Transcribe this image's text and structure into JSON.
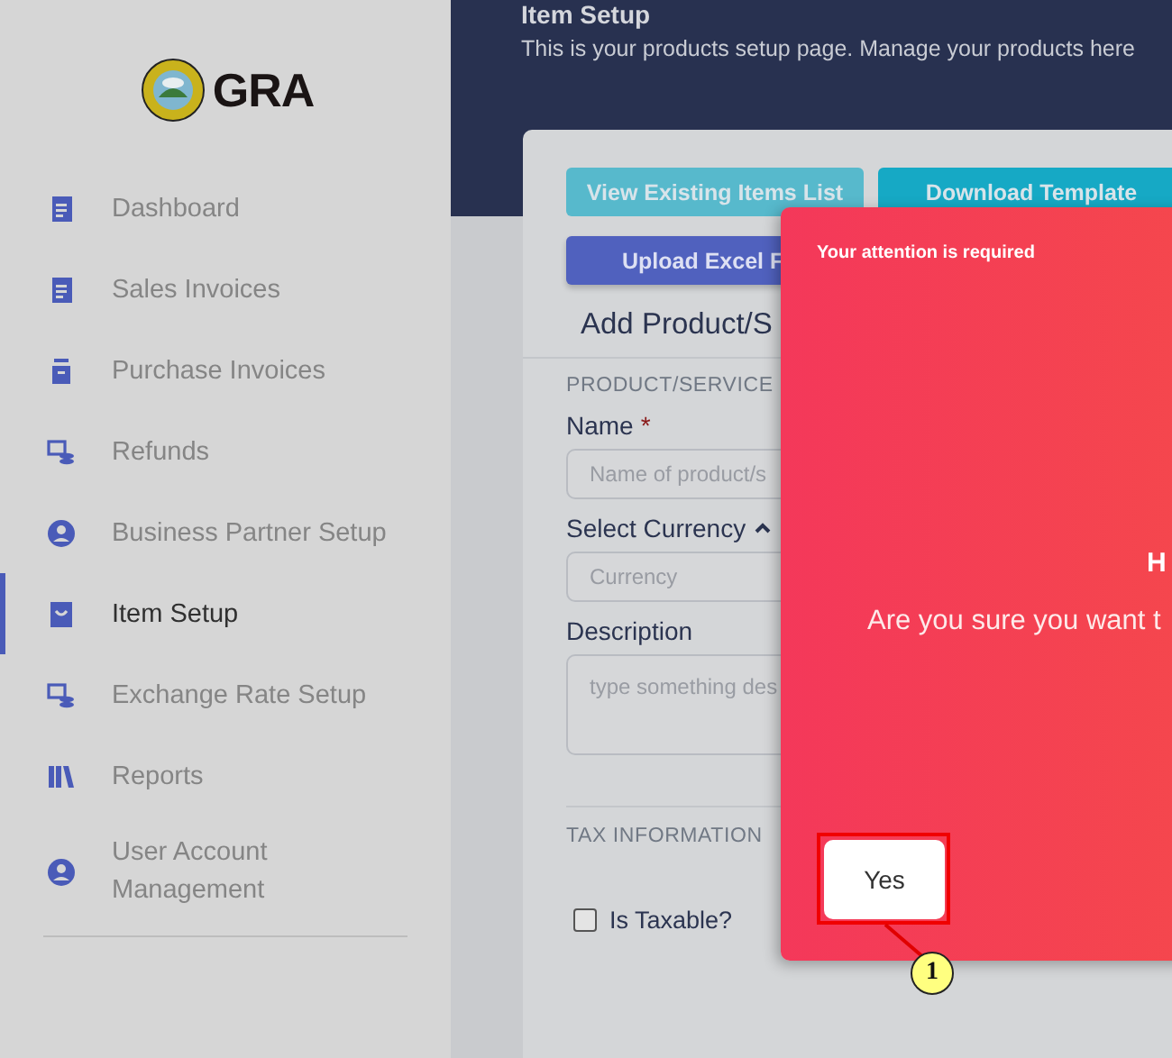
{
  "sidebar": {
    "logo_text": "GRA",
    "items": [
      {
        "label": "Dashboard",
        "selected": false
      },
      {
        "label": "Sales Invoices",
        "selected": false
      },
      {
        "label": "Purchase Invoices",
        "selected": false
      },
      {
        "label": "Refunds",
        "selected": false
      },
      {
        "label": "Business Partner Setup",
        "selected": false
      },
      {
        "label": "Item Setup",
        "selected": true
      },
      {
        "label": "Exchange Rate Setup",
        "selected": false
      },
      {
        "label": "Reports",
        "selected": false
      },
      {
        "label": "User Account Management",
        "selected": false
      }
    ]
  },
  "header": {
    "title": "Item Setup",
    "subtitle": "This is your products setup page. Manage your products here"
  },
  "card": {
    "buttons": [
      {
        "label": "View Existing Items List",
        "kind": "light"
      },
      {
        "label": "Download Template",
        "kind": "info"
      },
      {
        "label": "Upload Excel F",
        "kind": "primary"
      }
    ],
    "title": "Add Product/S",
    "section_1": "PRODUCT/SERVICE",
    "name_label": "Name",
    "required_mark": "*",
    "name_placeholder": "Name of product/s",
    "currency_label": "Select Currency",
    "currency_expanded": true,
    "currency_placeholder": "Currency",
    "description_label": "Description",
    "description_placeholder": "type something des",
    "section_2": "TAX INFORMATION",
    "taxable": {
      "label": "Is Taxable?",
      "checked": false
    }
  },
  "modal": {
    "header": "Your attention is required",
    "title": "H",
    "message": "Are you sure you want t",
    "confirm": "Yes"
  },
  "annotation": {
    "label": "1"
  }
}
